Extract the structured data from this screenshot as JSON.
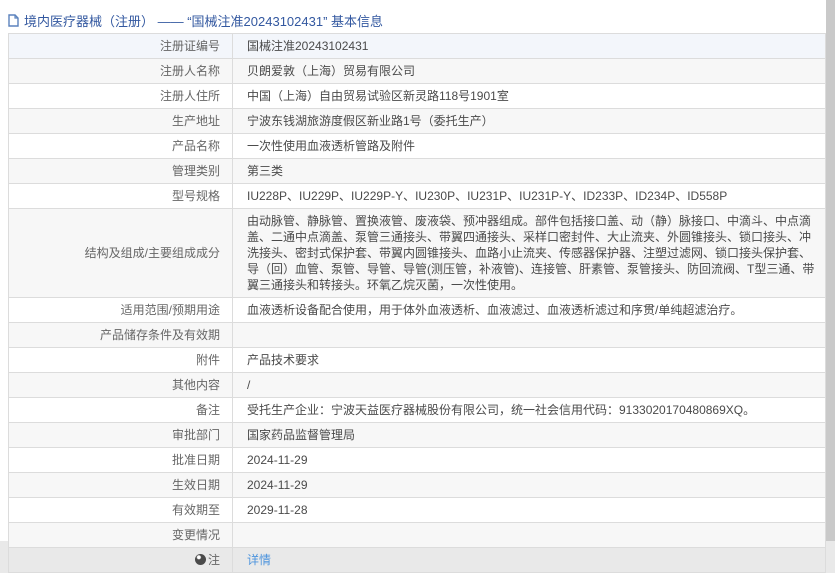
{
  "header": {
    "title": "境内医疗器械（注册） —— “国械注准20243102431” 基本信息",
    "icon": "document-icon"
  },
  "colors": {
    "title_blue": "#3358a0",
    "link_blue": "#4d94dd",
    "stripe_gray": "#f7f7f7",
    "first_row_highlight": "#f3f6fb",
    "table_border": "#c6c6c6"
  },
  "table": {
    "rows": [
      {
        "label": "注册证编号",
        "value": "国械注准20243102431"
      },
      {
        "label": "注册人名称",
        "value": "贝朗爱敦（上海）贸易有限公司"
      },
      {
        "label": "注册人住所",
        "value": "中国（上海）自由贸易试验区新灵路118号1901室"
      },
      {
        "label": "生产地址",
        "value": "宁波东钱湖旅游度假区新业路1号（委托生产）"
      },
      {
        "label": "产品名称",
        "value": "一次性使用血液透析管路及附件"
      },
      {
        "label": "管理类别",
        "value": "第三类"
      },
      {
        "label": "型号规格",
        "value": "IU228P、IU229P、IU229P-Y、IU230P、IU231P、IU231P-Y、ID233P、ID234P、ID558P"
      },
      {
        "label": "结构及组成/主要组成成分",
        "value": "由动脉管、静脉管、置换液管、废液袋、预冲器组成。部件包括接口盖、动（静）脉接口、中滴斗、中点滴盖、二通中点滴盖、泵管三通接头、带翼四通接头、采样口密封件、大止流夹、外圆锥接头、锁口接头、冲洗接头、密封式保护套、带翼内圆锥接头、血路小止流夹、传感器保护器、注塑过滤网、锁口接头保护套、导（回）血管、泵管、导管、导管(测压管，补液管)、连接管、肝素管、泵管接头、防回流阀、T型三通、带翼三通接头和转接头。环氧乙烷灭菌，一次性使用。"
      },
      {
        "label": "适用范围/预期用途",
        "value": "血液透析设备配合使用，用于体外血液透析、血液滤过、血液透析滤过和序贯/单纯超滤治疗。"
      },
      {
        "label": "产品储存条件及有效期",
        "value": ""
      },
      {
        "label": "附件",
        "value": "产品技术要求"
      },
      {
        "label": "其他内容",
        "value": "/"
      },
      {
        "label": "备注",
        "value": "受托生产企业：宁波天益医疗器械股份有限公司，统一社会信用代码：9133020170480869XQ。"
      },
      {
        "label": "审批部门",
        "value": "国家药品监督管理局"
      },
      {
        "label": "批准日期",
        "value": "2024-11-29"
      },
      {
        "label": "生效日期",
        "value": "2024-11-29"
      },
      {
        "label": "有效期至",
        "value": "2029-11-28"
      },
      {
        "label": "变更情况",
        "value": ""
      },
      {
        "label": "注",
        "value": "详情",
        "link": true
      }
    ]
  }
}
